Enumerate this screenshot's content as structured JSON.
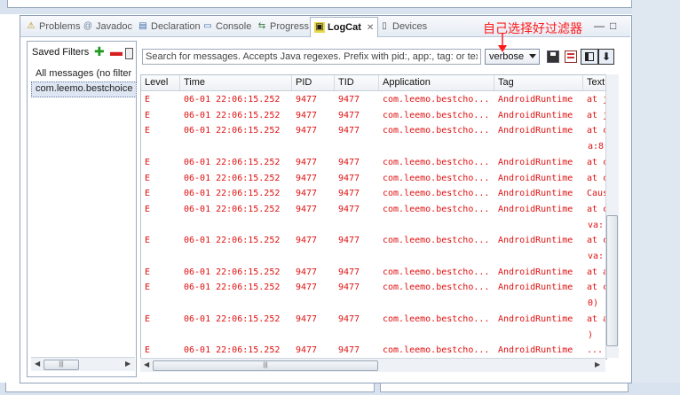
{
  "tabs": [
    {
      "label": "Problems",
      "icon": "problems-icon",
      "glyph": "⚠",
      "active": false
    },
    {
      "label": "Javadoc",
      "icon": "javadoc-icon",
      "glyph": "@",
      "active": false
    },
    {
      "label": "Declaration",
      "icon": "declaration-icon",
      "glyph": "▤",
      "active": false
    },
    {
      "label": "Console",
      "icon": "console-icon",
      "glyph": "▭",
      "active": false
    },
    {
      "label": "Progress",
      "icon": "progress-icon",
      "glyph": "⇆",
      "active": false
    },
    {
      "label": "LogCat",
      "icon": "logcat-icon",
      "glyph": "▣",
      "active": true,
      "close": "✕"
    },
    {
      "label": "Devices",
      "icon": "devices-icon",
      "glyph": "▯",
      "active": false
    }
  ],
  "view_controls": {
    "minimize": "—",
    "maximize": "□"
  },
  "annotation": "自己选择好过滤器",
  "saved_filters": {
    "title": "Saved Filters",
    "add": "✚",
    "remove": "▬",
    "items": [
      "All messages (no filter",
      "com.leemo.bestchoice"
    ],
    "selected_index": 1
  },
  "search": {
    "placeholder": "Search for messages. Accepts Java regexes. Prefix with pid:, app:, tag: or tex",
    "value": ""
  },
  "level_select": {
    "value": "verbose"
  },
  "scroll_lock": "⬇",
  "log": {
    "columns": [
      "Level",
      "Time",
      "PID",
      "TID",
      "Application",
      "Tag",
      "Text"
    ],
    "rows": [
      {
        "level": "E",
        "time": "06-01 22:06:15.252",
        "pid": "9477",
        "tid": "9477",
        "app": "com.leemo.bestcho...",
        "tag": "AndroidRuntime",
        "text": "at j"
      },
      {
        "level": "E",
        "time": "06-01 22:06:15.252",
        "pid": "9477",
        "tid": "9477",
        "app": "com.leemo.bestcho...",
        "tag": "AndroidRuntime",
        "text": "at j"
      },
      {
        "level": "E",
        "time": "06-01 22:06:15.252",
        "pid": "9477",
        "tid": "9477",
        "app": "com.leemo.bestcho...",
        "tag": "AndroidRuntime",
        "text": "at c",
        "cont": "a:8"
      },
      {
        "level": "E",
        "time": "06-01 22:06:15.252",
        "pid": "9477",
        "tid": "9477",
        "app": "com.leemo.bestcho...",
        "tag": "AndroidRuntime",
        "text": "at c"
      },
      {
        "level": "E",
        "time": "06-01 22:06:15.252",
        "pid": "9477",
        "tid": "9477",
        "app": "com.leemo.bestcho...",
        "tag": "AndroidRuntime",
        "text": "at c"
      },
      {
        "level": "E",
        "time": "06-01 22:06:15.252",
        "pid": "9477",
        "tid": "9477",
        "app": "com.leemo.bestcho...",
        "tag": "AndroidRuntime",
        "text": "Caus"
      },
      {
        "level": "E",
        "time": "06-01 22:06:15.252",
        "pid": "9477",
        "tid": "9477",
        "app": "com.leemo.bestcho...",
        "tag": "AndroidRuntime",
        "text": "at c",
        "cont": "va:"
      },
      {
        "level": "E",
        "time": "06-01 22:06:15.252",
        "pid": "9477",
        "tid": "9477",
        "app": "com.leemo.bestcho...",
        "tag": "AndroidRuntime",
        "text": "at c",
        "cont": "va:"
      },
      {
        "level": "E",
        "time": "06-01 22:06:15.252",
        "pid": "9477",
        "tid": "9477",
        "app": "com.leemo.bestcho...",
        "tag": "AndroidRuntime",
        "text": "at a"
      },
      {
        "level": "E",
        "time": "06-01 22:06:15.252",
        "pid": "9477",
        "tid": "9477",
        "app": "com.leemo.bestcho...",
        "tag": "AndroidRuntime",
        "text": "at c",
        "cont": "0)"
      },
      {
        "level": "E",
        "time": "06-01 22:06:15.252",
        "pid": "9477",
        "tid": "9477",
        "app": "com.leemo.bestcho...",
        "tag": "AndroidRuntime",
        "text": "at a",
        "cont": ")"
      },
      {
        "level": "E",
        "time": "06-01 22:06:15.252",
        "pid": "9477",
        "tid": "9477",
        "app": "com.leemo.bestcho...",
        "tag": "AndroidRuntime",
        "text": "..."
      }
    ]
  },
  "scrollbar_glyphs": {
    "left": "◀",
    "right": "▶",
    "grip": "|||"
  },
  "colors": {
    "error_text": "#e01010",
    "annotation": "#ff1a1a",
    "selection": "#dde6f2"
  }
}
